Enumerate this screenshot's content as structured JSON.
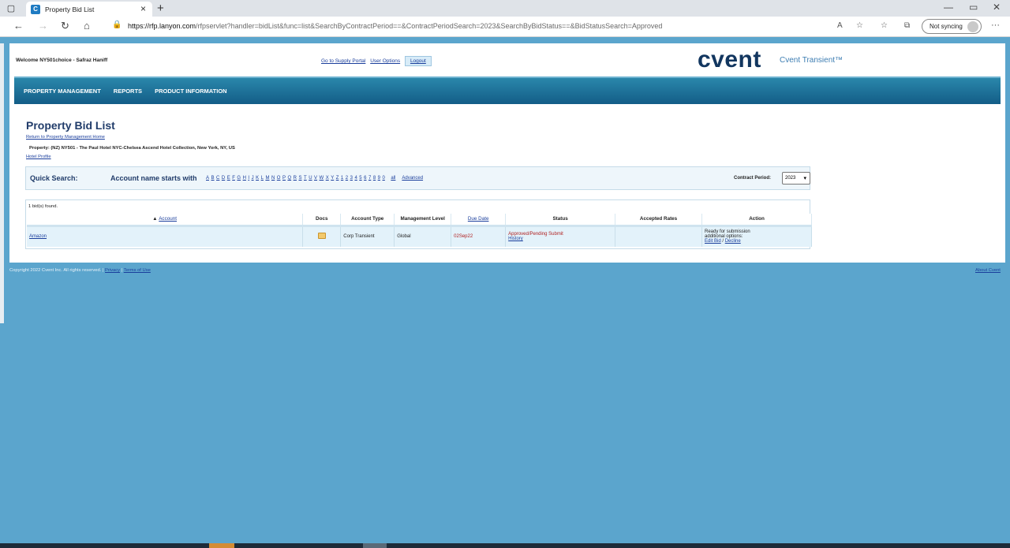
{
  "browser": {
    "tab_title": "Property Bid List",
    "tab_close_icon": "×",
    "new_tab_icon": "+",
    "url_host": "https://rfp.lanyon.com",
    "url_rest": "/rfpservlet?handler=bidList&func=list&SearchByContractPeriod==&ContractPeriodSearch=2023&SearchByBidStatus==&BidStatusSearch=Approved",
    "sync_label": "Not syncing",
    "icons": [
      "back-icon",
      "forward-icon",
      "reload-icon",
      "home-icon",
      "lock-icon",
      "read-aloud-icon",
      "favorite-icon",
      "favorites-icon",
      "collections-icon",
      "more-icon"
    ]
  },
  "header": {
    "welcome": "Welcome NY501choice - Safraz Haniff",
    "links": [
      "Go to Supply Portal",
      "User Options"
    ],
    "logout": "Logout",
    "logo": "cvent",
    "logo_sub": "Cvent Transient™"
  },
  "nav": [
    "PROPERTY MANAGEMENT",
    "REPORTS",
    "PRODUCT INFORMATION"
  ],
  "main": {
    "title": "Property Bid List",
    "return_link": "Return to Property Management Home",
    "property": "Property: (NZ) NY501 - The Paul Hotel NYC-Chelsea Ascend Hotel Collection, New York, NY, US",
    "hotel_profile": "Hotel Profile"
  },
  "quick_search": {
    "label": "Quick Search:",
    "starts_with": "Account name starts with",
    "letters": [
      "A",
      "B",
      "C",
      "D",
      "E",
      "F",
      "G",
      "H",
      "I",
      "J",
      "K",
      "L",
      "M",
      "N",
      "O",
      "P",
      "Q",
      "R",
      "S",
      "T",
      "U",
      "V",
      "W",
      "X",
      "Y",
      "Z",
      "1",
      "2",
      "3",
      "4",
      "5",
      "6",
      "7",
      "8",
      "9",
      "0"
    ],
    "all": "all",
    "advanced": "Advanced",
    "contract_period_label": "Contract Period:",
    "contract_period_value": "2023"
  },
  "results": {
    "found": "1 bid(s) found.",
    "headers": {
      "account": "Account",
      "docs": "Docs",
      "account_type": "Account Type",
      "management_level": "Management Level",
      "due_date": "Due Date",
      "status": "Status",
      "accepted_rates": "Accepted Rates",
      "action": "Action"
    },
    "rows": [
      {
        "account": "Amazon",
        "account_type": "Corp Transient",
        "management_level": "Global",
        "due_date": "02Sep22",
        "status": "Approved/Pending Submit",
        "history": "History",
        "accepted_rates": "",
        "action_text1": "Ready for submission",
        "action_text2": "additional options:",
        "edit_bid": "Edit Bid",
        "decline": "Decline"
      }
    ]
  },
  "footer": {
    "copyright": "Copyright 2022 Cvent Inc. All rights reserved. | ",
    "privacy": "Privacy",
    "terms": "Terms of Use",
    "about": "About Cvent"
  }
}
